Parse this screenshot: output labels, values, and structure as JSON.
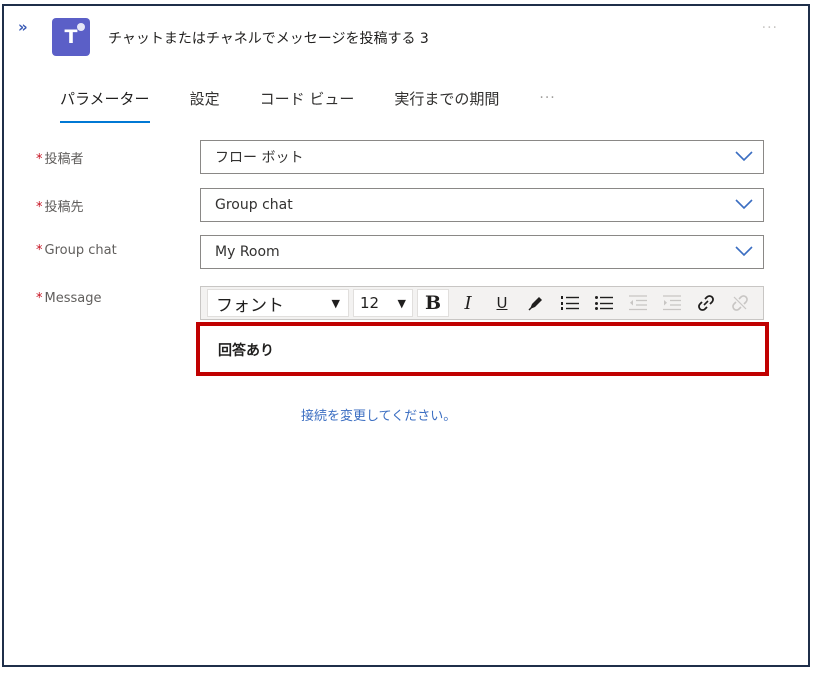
{
  "header": {
    "collapse_glyph": "»",
    "app_icon": "teams-icon",
    "app_icon_glyph": "T",
    "title": "チャットまたはチャネルでメッセージを投稿する 3",
    "more_glyph": "···"
  },
  "tabs": [
    {
      "label": "パラメーター",
      "active": true
    },
    {
      "label": "設定",
      "active": false
    },
    {
      "label": "コード ビュー",
      "active": false
    },
    {
      "label": "実行までの期間",
      "active": false
    }
  ],
  "tabs_more": "···",
  "form": {
    "poster": {
      "label": "投稿者",
      "value": "フロー ボット"
    },
    "post_in": {
      "label": "投稿先",
      "value": "Group chat"
    },
    "group_chat": {
      "label": "Group chat",
      "value": "My Room"
    },
    "message": {
      "label": "Message",
      "value": "回答あり"
    },
    "required_mark": "*"
  },
  "toolbar": {
    "font_label": "フォント",
    "font_size": "12",
    "dropdown_glyph": "▼",
    "bold": "B",
    "italic": "I",
    "underline": "U",
    "icons": [
      "pen-icon",
      "numbered-list-icon",
      "bullet-list-icon",
      "decrease-indent-icon",
      "increase-indent-icon",
      "link-icon",
      "unlink-icon"
    ]
  },
  "connection_link": "接続を変更してください。",
  "colors": {
    "highlight": "#c00000",
    "accent": "#0078d4",
    "teams": "#5b5fc7"
  }
}
